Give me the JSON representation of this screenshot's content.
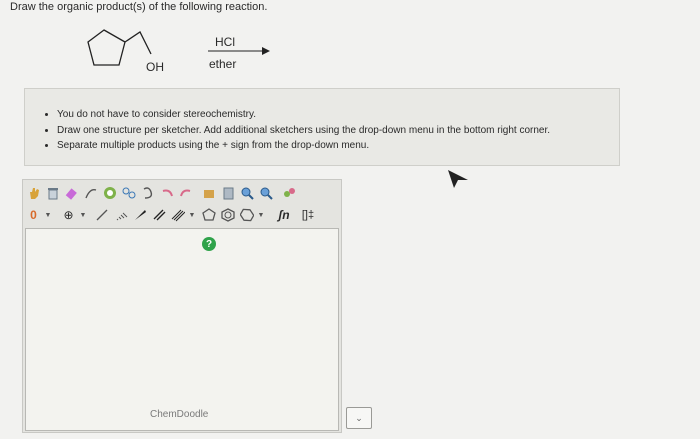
{
  "question": {
    "text": "Draw the organic product(s) of the following reaction."
  },
  "reaction": {
    "substituent_label": "OH",
    "reagent_top": "HCl",
    "reagent_bottom": "ether"
  },
  "instructions": [
    "You do not have to consider stereochemistry.",
    "Draw one structure per sketcher. Add additional sketchers using the drop-down menu in the bottom right corner.",
    "Separate multiple products using the + sign from the drop-down menu."
  ],
  "sketcher": {
    "charge_label": "0",
    "plus_minus_symbol": "⊕",
    "help_label": "?",
    "brand": "ChemDoodle",
    "template_label": "ʃn",
    "bracket_label": "[]‡",
    "accent_green": "#2fa24a"
  },
  "addon_dropdown": {
    "glyph": "⌄"
  }
}
